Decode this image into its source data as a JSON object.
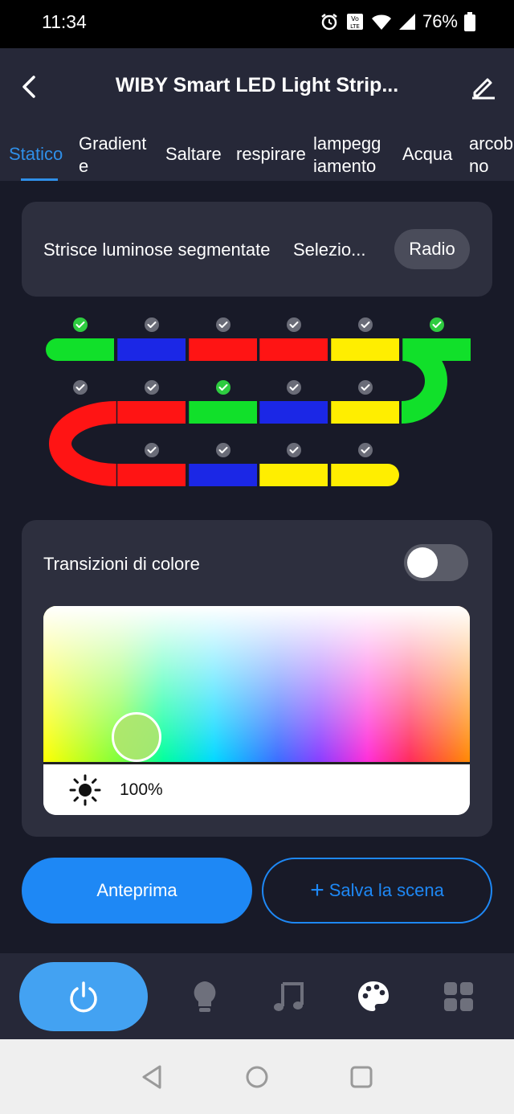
{
  "status_bar": {
    "time": "11:34",
    "battery": "76%",
    "icons": [
      "alarm-icon",
      "volte-icon",
      "wifi-icon",
      "signal-icon",
      "battery-icon"
    ]
  },
  "header": {
    "title": "WIBY Smart LED Light Strip...",
    "back_icon": "back-arrow-icon",
    "edit_icon": "edit-pencil-icon"
  },
  "tabs": [
    {
      "label": "Statico",
      "active": true
    },
    {
      "label": "Gradient\ne",
      "active": false
    },
    {
      "label": "Saltare",
      "active": false
    },
    {
      "label": "respirare",
      "active": false
    },
    {
      "label": "lampegg\niamento",
      "active": false
    },
    {
      "label": "Acqua",
      "active": false
    },
    {
      "label": "arcob\nno",
      "active": false
    }
  ],
  "segment_mode": {
    "label": "Strisce luminose segmentate",
    "options": [
      "Selezio...",
      "Radio"
    ],
    "selected": "Radio"
  },
  "led_segments": {
    "row1": [
      {
        "color": "#11e02a",
        "checked": true
      },
      {
        "color": "#1b27e6",
        "checked": false
      },
      {
        "color": "#ff1414",
        "checked": false
      },
      {
        "color": "#ff1414",
        "checked": false
      },
      {
        "color": "#ffee00",
        "checked": false
      },
      {
        "color": "#11e02a",
        "checked": true
      }
    ],
    "row2": [
      {
        "color": "#ff1414",
        "checked": false
      },
      {
        "color": "#ff1414",
        "checked": false
      },
      {
        "color": "#11e02a",
        "checked": true
      },
      {
        "color": "#1b27e6",
        "checked": false
      },
      {
        "color": "#ffee00",
        "checked": false
      }
    ],
    "row3": [
      {
        "color": "#ff1414",
        "checked": false
      },
      {
        "color": "#ff1414",
        "checked": false
      },
      {
        "color": "#1b27e6",
        "checked": false
      },
      {
        "color": "#ffee00",
        "checked": false
      },
      {
        "color": "#ffee00",
        "checked": false
      }
    ],
    "left_curve_color": "#ff1414",
    "right_curve_color": "#11e02a"
  },
  "color_transitions": {
    "label": "Transizioni di colore",
    "enabled": false
  },
  "brightness": {
    "value": "100%",
    "icon": "sun-icon"
  },
  "actions": {
    "preview_label": "Anteprima",
    "save_label": "Salva la scena"
  },
  "bottom_nav": {
    "items": [
      "power-icon",
      "bulb-icon",
      "music-icon",
      "palette-icon",
      "grid-icon"
    ],
    "active": "power-icon"
  },
  "colors": {
    "accent": "#1e88f5",
    "background": "#181a28",
    "card": "#2d2f3e",
    "check_active": "#2ecc40",
    "check_inactive": "#6a6c78"
  }
}
